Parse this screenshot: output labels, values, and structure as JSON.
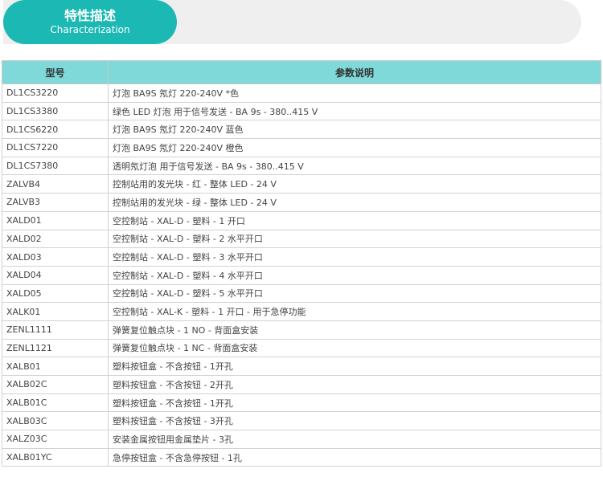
{
  "header": {
    "title": "特性描述",
    "subtitle": "Characterization"
  },
  "table": {
    "columns": [
      "型号",
      "参数说明"
    ],
    "rows": [
      [
        "DL1CS3220",
        "灯泡 BA9S 氖灯 220-240V *色"
      ],
      [
        "DL1CS3380",
        "绿色 LED 灯泡 用于信号发送 - BA 9s - 380..415 V"
      ],
      [
        "DL1CS6220",
        "灯泡 BA9S 氖灯 220-240V 蓝色"
      ],
      [
        "DL1CS7220",
        "灯泡 BA9S 氖灯 220-240V 橙色"
      ],
      [
        "DL1CS7380",
        "透明氖灯泡 用于信号发送 - BA 9s - 380..415 V"
      ],
      [
        "ZALVB4",
        "控制站用的发光块 - 红 - 整体 LED - 24 V"
      ],
      [
        "ZALVB3",
        "控制站用的发光块 - 绿 - 整体 LED - 24 V"
      ],
      [
        "XALD01",
        "空控制站 - XAL-D - 塑料 - 1 开口"
      ],
      [
        "XALD02",
        "空控制站 - XAL-D - 塑料 - 2 水平开口"
      ],
      [
        "XALD03",
        "空控制站 - XAL-D - 塑料 - 3 水平开口"
      ],
      [
        "XALD04",
        "空控制站 - XAL-D - 塑料 - 4 水平开口"
      ],
      [
        "XALD05",
        "空控制站 - XAL-D - 塑料 - 5 水平开口"
      ],
      [
        "XALK01",
        "空控制站 - XAL-K - 塑料 - 1 开口 - 用于急停功能"
      ],
      [
        "ZENL1111",
        "弹簧复位触点块 - 1 NO - 背面盒安装"
      ],
      [
        "ZENL1121",
        "弹簧复位触点块 - 1 NC - 背面盒安装"
      ],
      [
        "XALB01",
        "塑料按钮盒 - 不含按钮 - 1开孔"
      ],
      [
        "XALB02C",
        "塑料按钮盒 - 不含按钮 - 2开孔"
      ],
      [
        "XALB01C",
        "塑料按钮盒 - 不含按钮 - 1开孔"
      ],
      [
        "XALB03C",
        "塑料按钮盒 - 不含按钮 - 3开孔"
      ],
      [
        "XALZ03C",
        "安装金属按钮用金属垫片 - 3孔"
      ],
      [
        "XALB01YC",
        "急停按钮盒 - 不含急停按钮 - 1孔"
      ]
    ]
  }
}
